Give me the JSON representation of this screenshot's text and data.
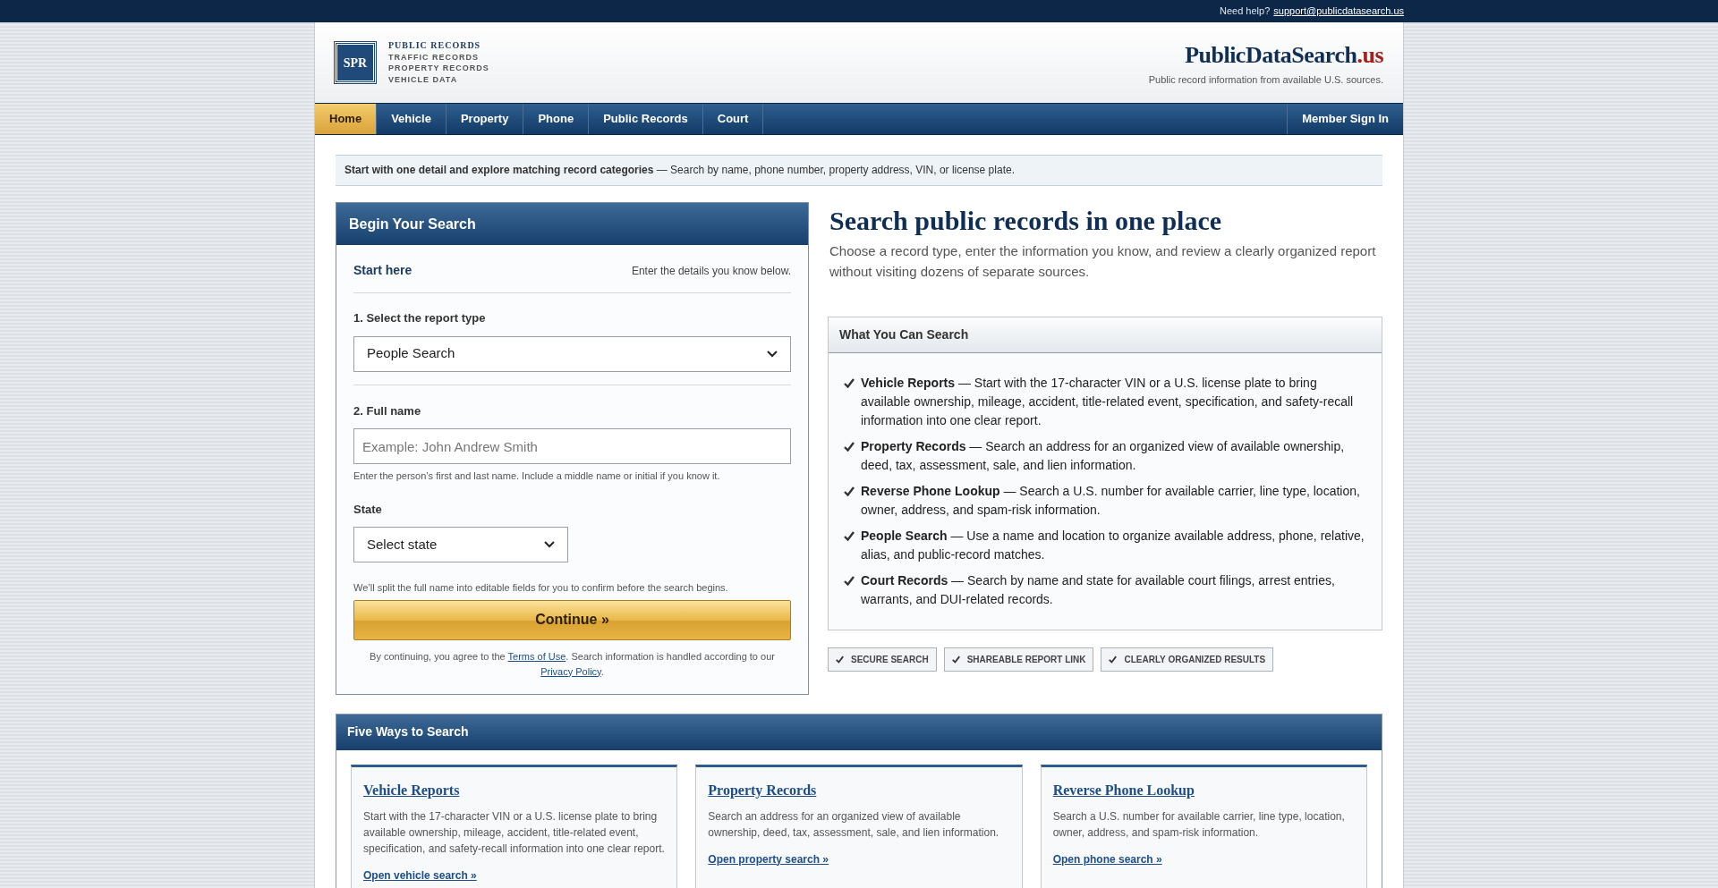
{
  "top_bar": {
    "text": "Need help?",
    "link": "support@publicdatasearch.us"
  },
  "header": {
    "logo_mark": "SPR",
    "taglines": [
      "PUBLIC RECORDS",
      "TRAFFIC RECORDS",
      "PROPERTY RECORDS",
      "VEHICLE DATA"
    ],
    "brand": {
      "name": "PublicDataSearch",
      "tld": ".us"
    },
    "subtitle": "Public record information from available U.S. sources."
  },
  "nav": {
    "items": [
      {
        "label": "Home",
        "selected": true
      },
      {
        "label": "Vehicle",
        "selected": false
      },
      {
        "label": "Property",
        "selected": false
      },
      {
        "label": "Phone",
        "selected": false
      },
      {
        "label": "Public Records",
        "selected": false
      },
      {
        "label": "Court",
        "selected": false
      }
    ],
    "sign_in": "Member Sign In"
  },
  "notice": "**Start with one detail and explore matching record categories** — Search by name, phone number, property address, VIN, or license plate.",
  "search_form": {
    "title": "Begin Your Search",
    "start_here": "Start here",
    "hint": "Enter the details you know below.",
    "fields": [
      {
        "kind": "select",
        "label": "1. Select the report type",
        "value": "People Search",
        "divider": true
      },
      {
        "kind": "text",
        "label": "2. Full name",
        "placeholder": "Example: John Andrew Smith",
        "help": "Enter the person’s first and last name. Include a middle name or initial if you know it."
      },
      {
        "kind": "select",
        "label": "State",
        "value": "Select state",
        "narrow": true
      }
    ],
    "note": "We’ll split the full name into editable fields for you to confirm before the search begins.",
    "button": "Continue »",
    "legal": {
      "before": "By continuing, you agree to the ",
      "terms": "Terms of Use",
      "middle": ". Search information is handled according to our ",
      "privacy": "Privacy Policy",
      "after": "."
    }
  },
  "intro": {
    "title": "Search public records in one place",
    "text": "Choose a record type, enter the information you know, and review a clearly organized report without visiting dozens of separate sources."
  },
  "features": {
    "title": "What You Can Search",
    "items": [
      "**Vehicle Reports** — Start with the 17-character VIN or a U.S. license plate to bring available ownership, mileage, accident, title-related event, specification, and safety-recall information into one clear report.",
      "**Property Records** — Search an address for an organized view of available ownership, deed, tax, assessment, sale, and lien information.",
      "**Reverse Phone Lookup** — Search a U.S. number for available carrier, line type, location, owner, address, and spam-risk information.",
      "**People Search** — Use a name and location to organize available address, phone, relative, alias, and public-record matches.",
      "**Court Records** — Search by name and state for available court filings, arrest entries, warrants, and DUI-related records."
    ]
  },
  "badges": [
    "SECURE SEARCH",
    "SHAREABLE REPORT LINK",
    "CLEARLY ORGANIZED RESULTS"
  ],
  "five_ways": {
    "title": "Five Ways to Search",
    "cards": [
      {
        "title": "Vehicle Reports",
        "text": "Start with the 17-character VIN or a U.S. license plate to bring available ownership, mileage, accident, title-related event, specification, and safety-recall information into one clear report.",
        "link": "Open vehicle search »"
      },
      {
        "title": "Property Records",
        "text": "Search an address for an organized view of available ownership, deed, tax, assessment, sale, and lien information.",
        "link": "Open property search »"
      },
      {
        "title": "Reverse Phone Lookup",
        "text": "Search a U.S. number for available carrier, line type, location, owner, address, and spam-risk information.",
        "link": "Open phone search »"
      }
    ]
  }
}
